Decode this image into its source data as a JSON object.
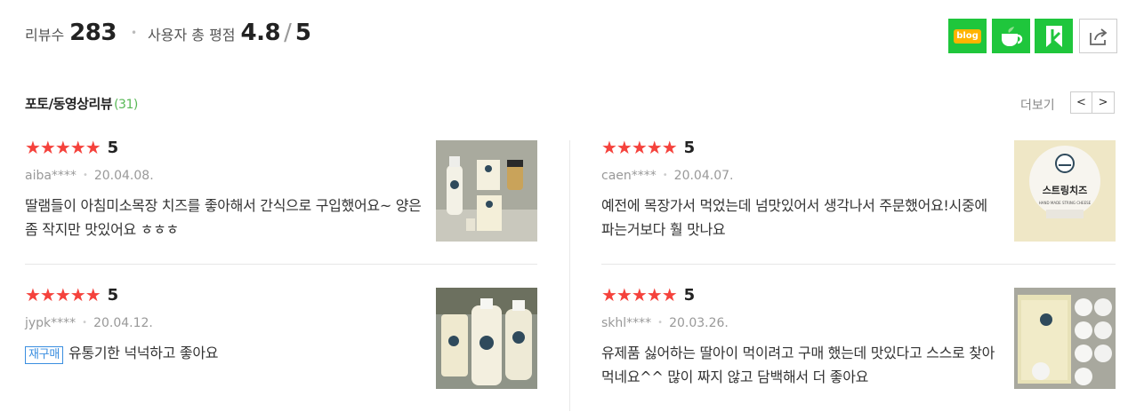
{
  "summary": {
    "review_label": "리뷰수",
    "review_count": "283",
    "rating_label": "사용자 총 평점",
    "rating_value": "4.8",
    "rating_max": "5"
  },
  "share": {
    "blog_text": "blog",
    "icons": [
      "blog-icon",
      "cafe-icon",
      "keep-icon",
      "share-icon"
    ],
    "brand_color": "#1fc63c"
  },
  "photo_reviews": {
    "title": "포토/동영상리뷰",
    "count": "(31)",
    "more_label": "더보기",
    "prev": "<",
    "next": ">"
  },
  "reviews": [
    {
      "stars": "★★★★★",
      "score": "5",
      "user": "aiba****",
      "date": "20.04.08.",
      "text": "딸램들이 아침미소목장 치즈를 좋아해서 간식으로 구입했어요~ 양은 좀 작지만 맛있어요 ㅎㅎㅎ"
    },
    {
      "stars": "★★★★★",
      "score": "5",
      "user": "caen****",
      "date": "20.04.07.",
      "text": "예전에 목장가서 먹었는데 넘맛있어서 생각나서 주문했어요!시중에 파는거보다 훨 맛나요",
      "image_label": "스트링치즈",
      "image_sublabel": "HAND MADE STRING CHEESE"
    },
    {
      "stars": "★★★★★",
      "score": "5",
      "user": "jypk****",
      "date": "20.04.12.",
      "badge": "재구매",
      "text": "유통기한 넉넉하고 좋아요"
    },
    {
      "stars": "★★★★★",
      "score": "5",
      "user": "skhl****",
      "date": "20.03.26.",
      "text": "유제품 싫어하는 딸아이 먹이려고 구매 했는데 맛있다고 스스로 찾아 먹네요^^ 많이 짜지 않고 담백해서 더 좋아요"
    }
  ],
  "colors": {
    "star": "#f5423c",
    "count_green": "#58b856",
    "rebuy_blue": "#3a8ee0"
  }
}
